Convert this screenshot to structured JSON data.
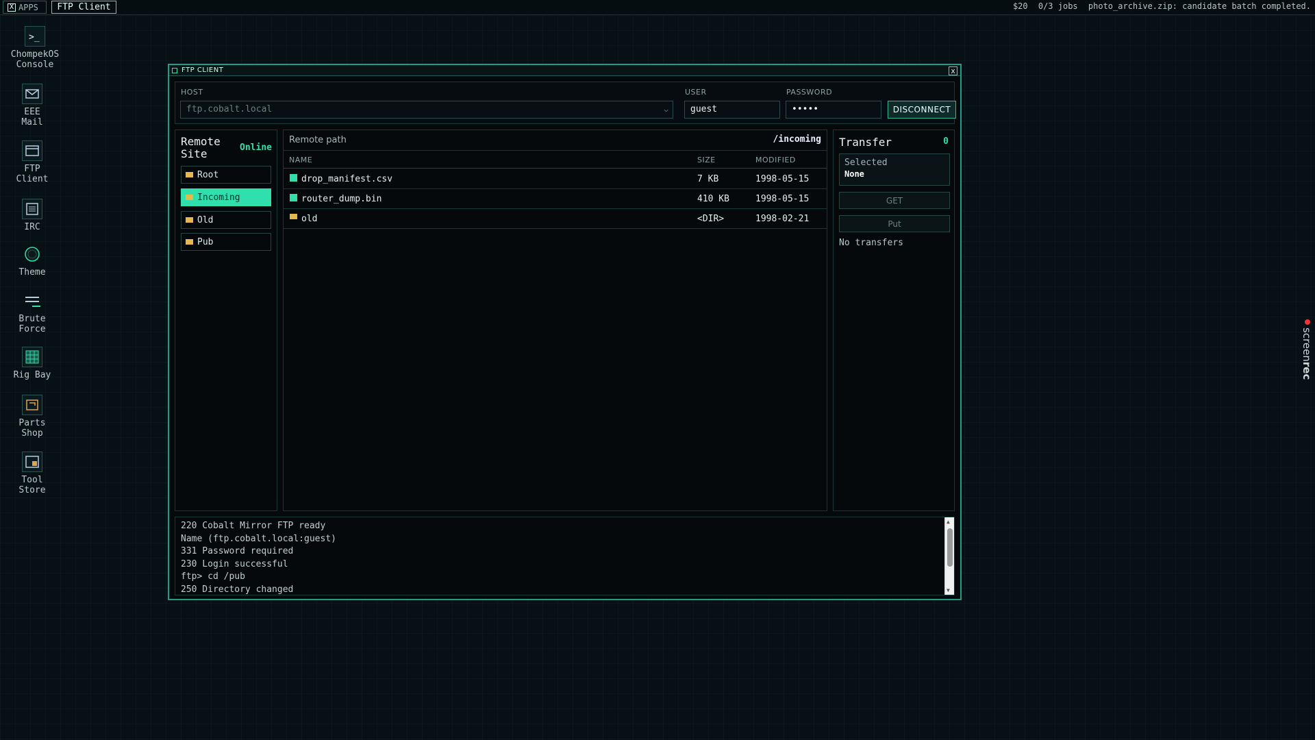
{
  "topbar": {
    "apps_label": "APPS",
    "active_app": "FTP Client",
    "status": {
      "money": "$20",
      "jobs": "0/3 jobs",
      "message": "photo_archive.zip: candidate batch completed."
    }
  },
  "desktop_icons": [
    {
      "label_1": "ChompekOS",
      "label_2": "Console",
      "icon": "terminal-icon"
    },
    {
      "label_1": "EEE",
      "label_2": "Mail",
      "icon": "mail-icon"
    },
    {
      "label_1": "FTP",
      "label_2": "Client",
      "icon": "ftp-icon"
    },
    {
      "label_1": "IRC",
      "label_2": "",
      "icon": "irc-icon"
    },
    {
      "label_1": "Theme",
      "label_2": "",
      "icon": "theme-icon"
    },
    {
      "label_1": "Brute",
      "label_2": "Force",
      "icon": "brute-force-icon"
    },
    {
      "label_1": "Rig Bay",
      "label_2": "",
      "icon": "rig-bay-icon"
    },
    {
      "label_1": "Parts",
      "label_2": "Shop",
      "icon": "parts-shop-icon"
    },
    {
      "label_1": "Tool",
      "label_2": "Store",
      "icon": "tool-store-icon"
    }
  ],
  "window": {
    "title": "FTP CLIENT",
    "close": "x",
    "connection": {
      "host_label": "HOST",
      "host_value": "ftp.cobalt.local",
      "user_label": "USER",
      "user_value": "guest",
      "password_label": "PASSWORD",
      "password_value": "•••••",
      "disconnect_label": "DISCONNECT"
    },
    "remote_site": {
      "title": "Remote Site",
      "status": "Online",
      "items": [
        {
          "label": "Root",
          "active": false
        },
        {
          "label": "Incoming",
          "active": true
        },
        {
          "label": "Old",
          "active": false
        },
        {
          "label": "Pub",
          "active": false
        }
      ]
    },
    "files": {
      "path_label": "Remote path",
      "path_value": "/incoming",
      "columns": {
        "name": "NAME",
        "size": "SIZE",
        "modified": "MODIFIED"
      },
      "rows": [
        {
          "name": "drop_manifest.csv",
          "size": "7 KB",
          "modified": "1998-05-15",
          "type": "file"
        },
        {
          "name": "router_dump.bin",
          "size": "410 KB",
          "modified": "1998-05-15",
          "type": "file"
        },
        {
          "name": "old",
          "size": "<DIR>",
          "modified": "1998-02-21",
          "type": "dir"
        }
      ]
    },
    "transfer": {
      "title": "Transfer",
      "count": "0",
      "selected_label": "Selected",
      "selected_value": "None",
      "get_label": "GET",
      "put_label": "Put",
      "empty_label": "No transfers"
    },
    "console_log": [
      "220 Cobalt Mirror FTP ready",
      "Name (ftp.cobalt.local:guest)",
      "331 Password required",
      "230 Login successful",
      "ftp> cd /pub",
      "250 Directory changed"
    ]
  },
  "watermark": {
    "text_light": "screen",
    "text_bold": "rec"
  },
  "colors": {
    "accent": "#2fe0ad",
    "folder": "#e6b84a",
    "border": "#1f9e87"
  }
}
